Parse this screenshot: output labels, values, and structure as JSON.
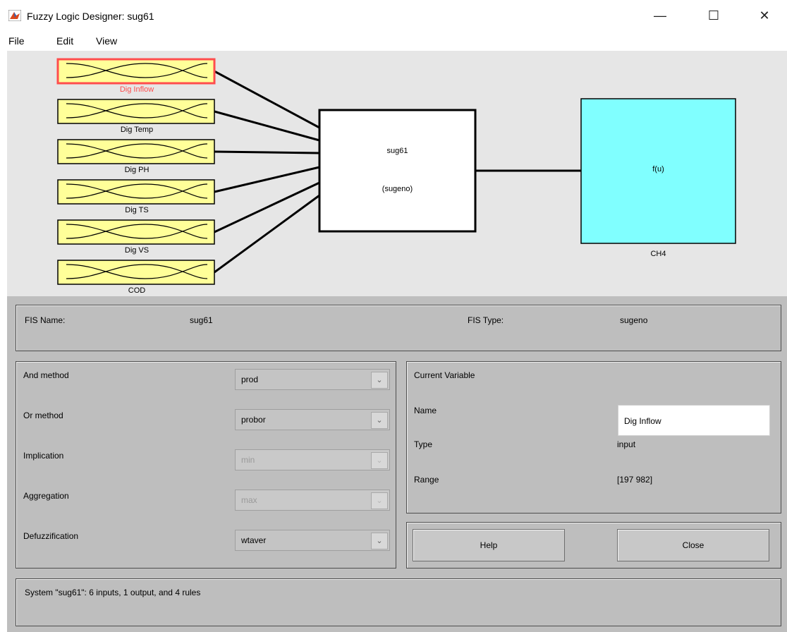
{
  "window": {
    "title": "Fuzzy Logic Designer: sug61",
    "controls": [
      "—",
      "☐",
      "✕"
    ]
  },
  "menu": [
    "File",
    "Edit",
    "View"
  ],
  "diagram": {
    "inputs": [
      "Dig Inflow",
      "Dig Temp",
      "Dig PH",
      "Dig TS",
      "Dig VS",
      "COD"
    ],
    "selected_input_color": "#ff4d4d",
    "fis_box": {
      "name": "sug61",
      "type": "(sugeno)"
    },
    "output": {
      "function": "f(u)",
      "name": "CH4",
      "color": "#80ffff"
    },
    "input_box_color": "#ffff99"
  },
  "fis_info": {
    "name_label": "FIS Name:",
    "name_value": "sug61",
    "type_label": "FIS Type:",
    "type_value": "sugeno"
  },
  "methods": {
    "and": {
      "label": "And method",
      "value": "prod"
    },
    "or": {
      "label": "Or method",
      "value": "probor"
    },
    "implication": {
      "label": "Implication",
      "value": "min"
    },
    "aggregation": {
      "label": "Aggregation",
      "value": "max"
    },
    "defuzzification": {
      "label": "Defuzzification",
      "value": "wtaver"
    }
  },
  "current_variable": {
    "title": "Current Variable",
    "name_label": "Name",
    "name_value": "Dig Inflow",
    "type_label": "Type",
    "type_value": "input",
    "range_label": "Range",
    "range_value": "[197 982]"
  },
  "buttons": {
    "help": "Help",
    "close": "Close"
  },
  "status": "System \"sug61\": 6 inputs, 1 output, and 4 rules"
}
